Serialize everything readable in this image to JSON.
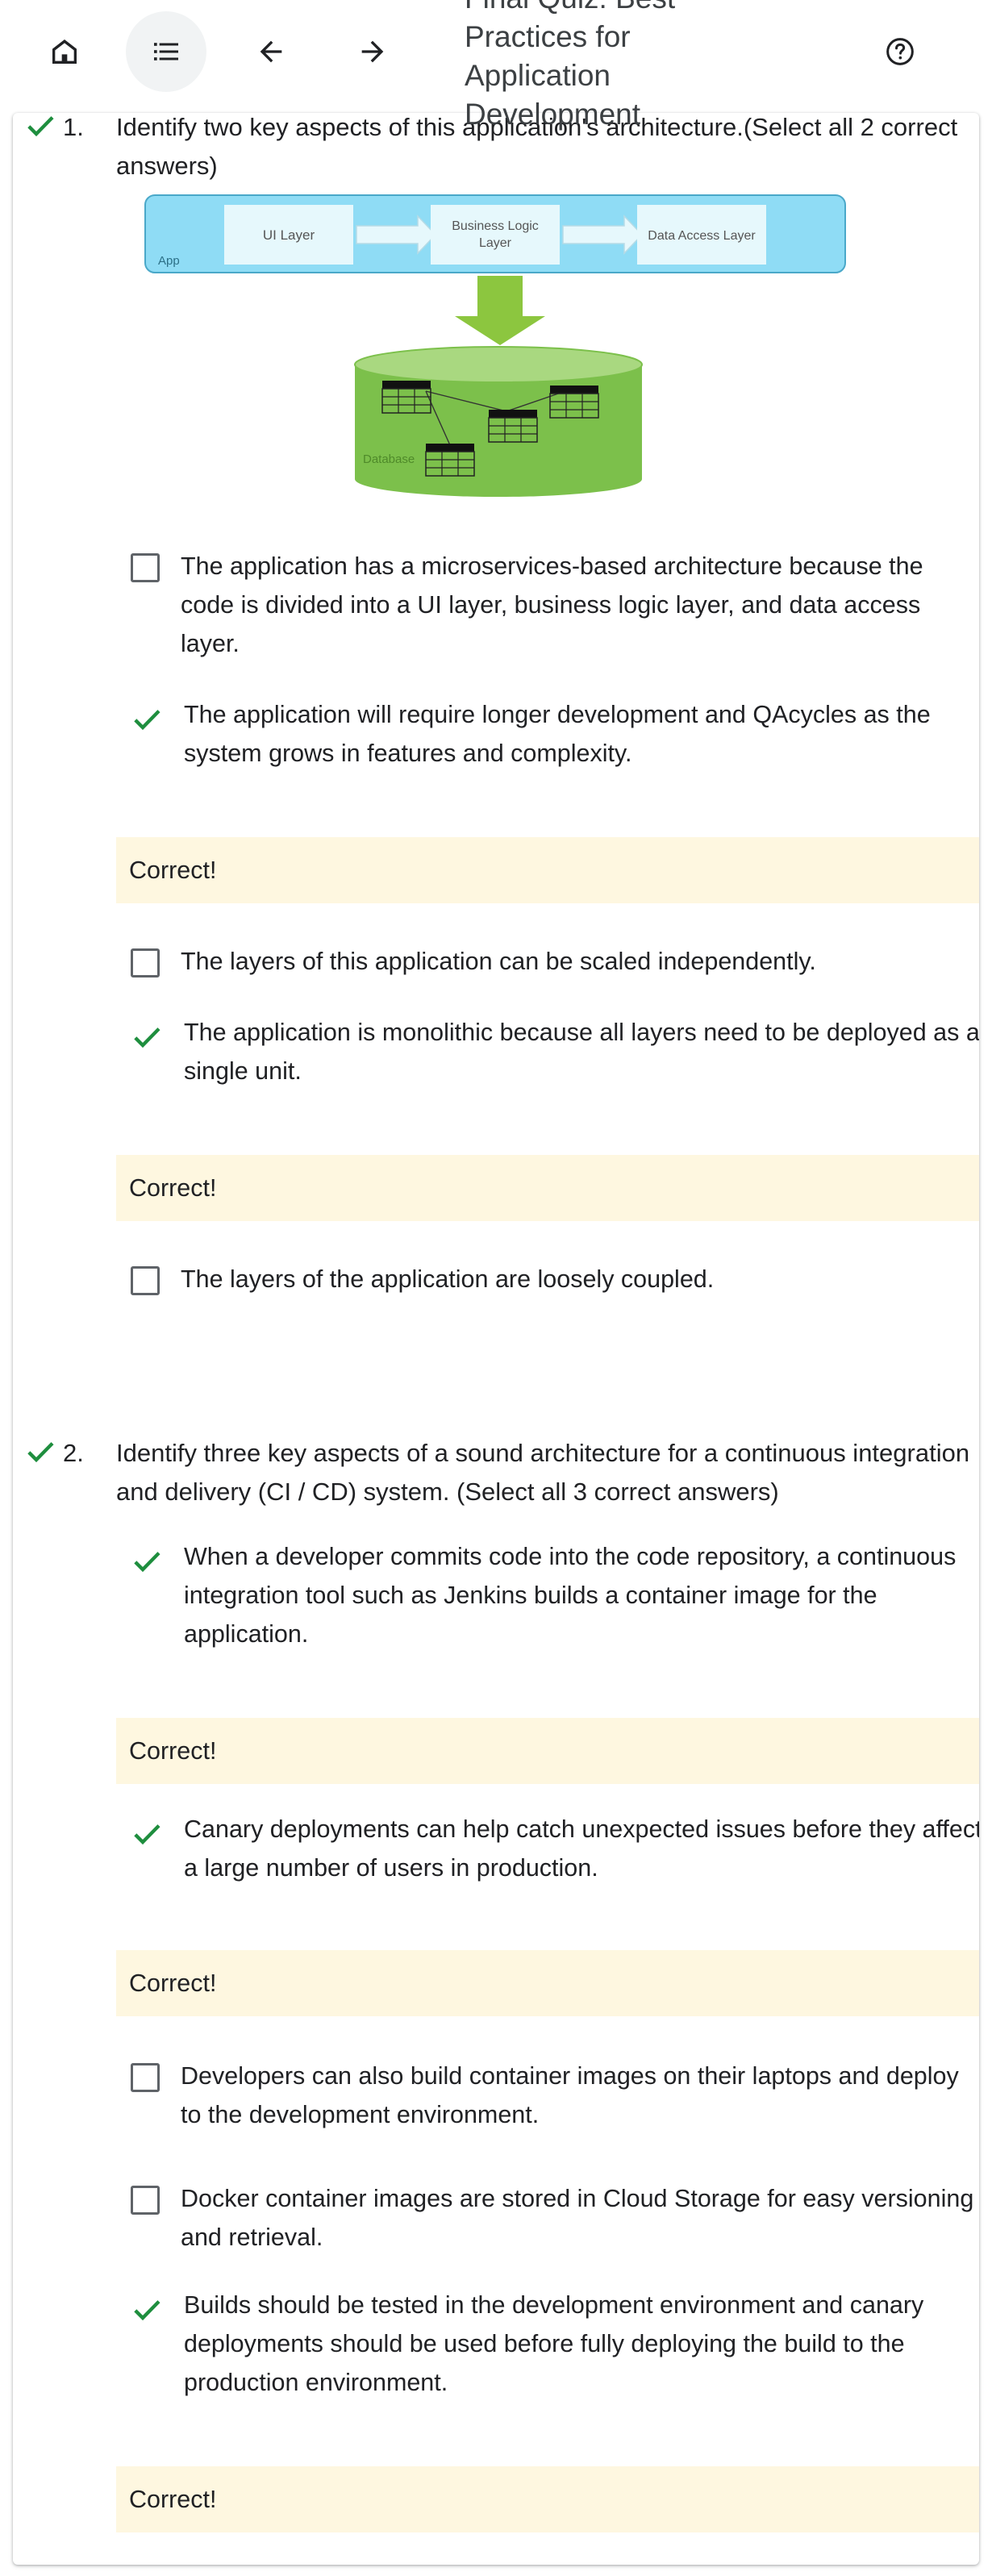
{
  "header": {
    "title": "Final Quiz: Best Practices for Application Development",
    "icons": [
      "home-icon",
      "list-icon",
      "arrow-back-icon",
      "arrow-forward-icon",
      "help-icon"
    ]
  },
  "diagram": {
    "app_label": "App",
    "ui_layer": "UI Layer",
    "business_logic": [
      "Business Logic",
      "Layer"
    ],
    "data_access": "Data Access Layer",
    "database_label": "Database"
  },
  "questions": [
    {
      "number": "1.",
      "status": "correct",
      "text": "Identify two key aspects of this application's architecture.(Select all 2 correct answers)",
      "options": [
        {
          "text": "The application has a microservices-based architecture because the code is divided into a UI layer, business logic layer, and data access layer.",
          "selected": false,
          "feedback": ""
        },
        {
          "text": "The application will require longer development and QAcycles as the system grows in features and complexity.",
          "selected": true,
          "feedback": "Correct!"
        },
        {
          "text": "The layers of this application can be scaled independently.",
          "selected": false,
          "feedback": ""
        },
        {
          "text": "The application is monolithic because all layers need to be deployed as a single unit.",
          "selected": true,
          "feedback": "Correct!"
        },
        {
          "text": "The layers of the application are loosely coupled.",
          "selected": false,
          "feedback": ""
        }
      ]
    },
    {
      "number": "2.",
      "status": "correct",
      "text": "Identify three key aspects of a sound architecture for a continuous integration and delivery (CI / CD) system. (Select all 3 correct answers)",
      "options": [
        {
          "text": "When a developer commits code into the code repository, a continuous integration tool such as Jenkins builds a container image for the application.",
          "selected": true,
          "feedback": "Correct!"
        },
        {
          "text": "Canary deployments can help catch unexpected issues before they affect a large number of users in production.",
          "selected": true,
          "feedback": "Correct!"
        },
        {
          "text": "Developers can also build container images on their laptops and deploy to the development environment.",
          "selected": false,
          "feedback": ""
        },
        {
          "text": "Docker container images are stored in Cloud Storage for easy versioning and retrieval.",
          "selected": false,
          "feedback": ""
        },
        {
          "text": "Builds should be tested in the development environment and canary deployments should be used before fully deploying the build to the production environment.",
          "selected": true,
          "feedback": "Correct!"
        }
      ]
    }
  ],
  "colors": {
    "check_green": "#1e8e3e",
    "feedback_bg": "#fef7e0",
    "app_box": "#8fdcf5",
    "layer_box": "#e6f8fc",
    "db_green": "#7cc04b",
    "arrow_green": "#8cc63f"
  }
}
